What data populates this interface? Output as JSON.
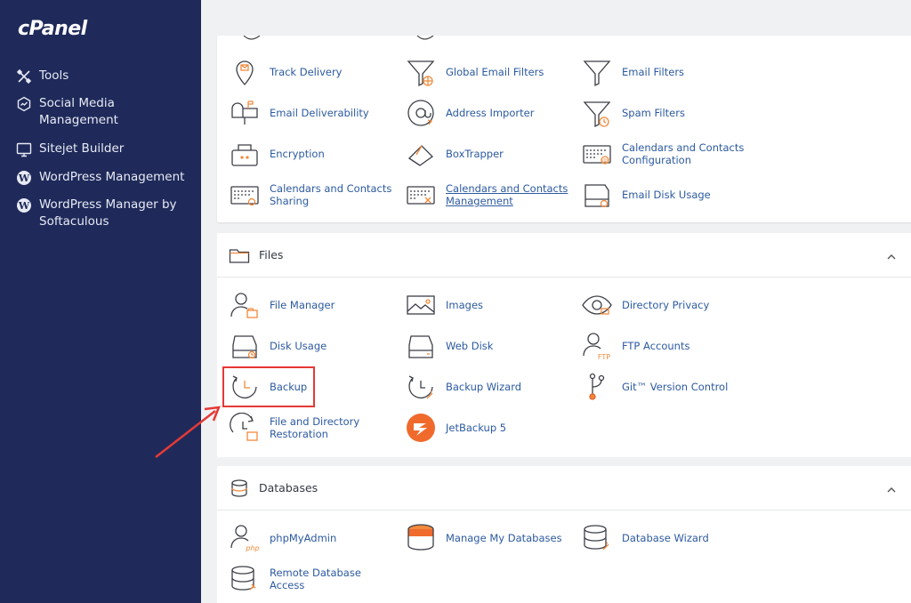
{
  "sidebar": {
    "logo": "cPanel",
    "items": [
      {
        "label": "Tools",
        "icon": "tools-icon"
      },
      {
        "label": "Social Media Management",
        "icon": "social-media-icon"
      },
      {
        "label": "Sitejet Builder",
        "icon": "sitejet-icon"
      },
      {
        "label": "WordPress Management",
        "icon": "wordpress-icon"
      },
      {
        "label": "WordPress Manager by Softaculous",
        "icon": "wordpress-icon"
      }
    ]
  },
  "email_section": {
    "items": [
      {
        "label": "Track Delivery",
        "icon": "track-delivery-icon"
      },
      {
        "label": "Global Email Filters",
        "icon": "global-filter-icon"
      },
      {
        "label": "Email Filters",
        "icon": "filter-icon"
      },
      {
        "label": "Email Deliverability",
        "icon": "mailbox-icon"
      },
      {
        "label": "Address Importer",
        "icon": "address-importer-icon"
      },
      {
        "label": "Spam Filters",
        "icon": "spam-filter-icon"
      },
      {
        "label": "Encryption",
        "icon": "encryption-icon"
      },
      {
        "label": "BoxTrapper",
        "icon": "boxtrapper-icon"
      },
      {
        "label": "Calendars and Contacts Configuration",
        "icon": "calendar-config-icon"
      },
      {
        "label": "Calendars and Contacts Sharing",
        "icon": "calendar-sharing-icon"
      },
      {
        "label": "Calendars and Contacts Management",
        "icon": "calendar-management-icon"
      },
      {
        "label": "Email Disk Usage",
        "icon": "email-disk-usage-icon"
      }
    ]
  },
  "files_section": {
    "title": "Files",
    "items": [
      {
        "label": "File Manager",
        "icon": "file-manager-icon"
      },
      {
        "label": "Images",
        "icon": "images-icon"
      },
      {
        "label": "Directory Privacy",
        "icon": "directory-privacy-icon"
      },
      {
        "label": "Disk Usage",
        "icon": "disk-usage-icon"
      },
      {
        "label": "Web Disk",
        "icon": "web-disk-icon"
      },
      {
        "label": "FTP Accounts",
        "icon": "ftp-accounts-icon"
      },
      {
        "label": "Backup",
        "icon": "backup-icon"
      },
      {
        "label": "Backup Wizard",
        "icon": "backup-wizard-icon"
      },
      {
        "label": "Git™ Version Control",
        "icon": "git-icon"
      },
      {
        "label": "File and Directory Restoration",
        "icon": "restoration-icon"
      },
      {
        "label": "JetBackup 5",
        "icon": "jetbackup-icon"
      }
    ]
  },
  "databases_section": {
    "title": "Databases",
    "items": [
      {
        "label": "phpMyAdmin",
        "icon": "phpmyadmin-icon"
      },
      {
        "label": "Manage My Databases",
        "icon": "manage-databases-icon"
      },
      {
        "label": "Database Wizard",
        "icon": "database-wizard-icon"
      },
      {
        "label": "Remote Database Access",
        "icon": "remote-database-icon"
      }
    ]
  },
  "colors": {
    "sidebar_bg": "#1f2a5a",
    "link": "#2c5aa0",
    "accent_orange": "#f08a3c",
    "highlight_red": "#e53935"
  }
}
